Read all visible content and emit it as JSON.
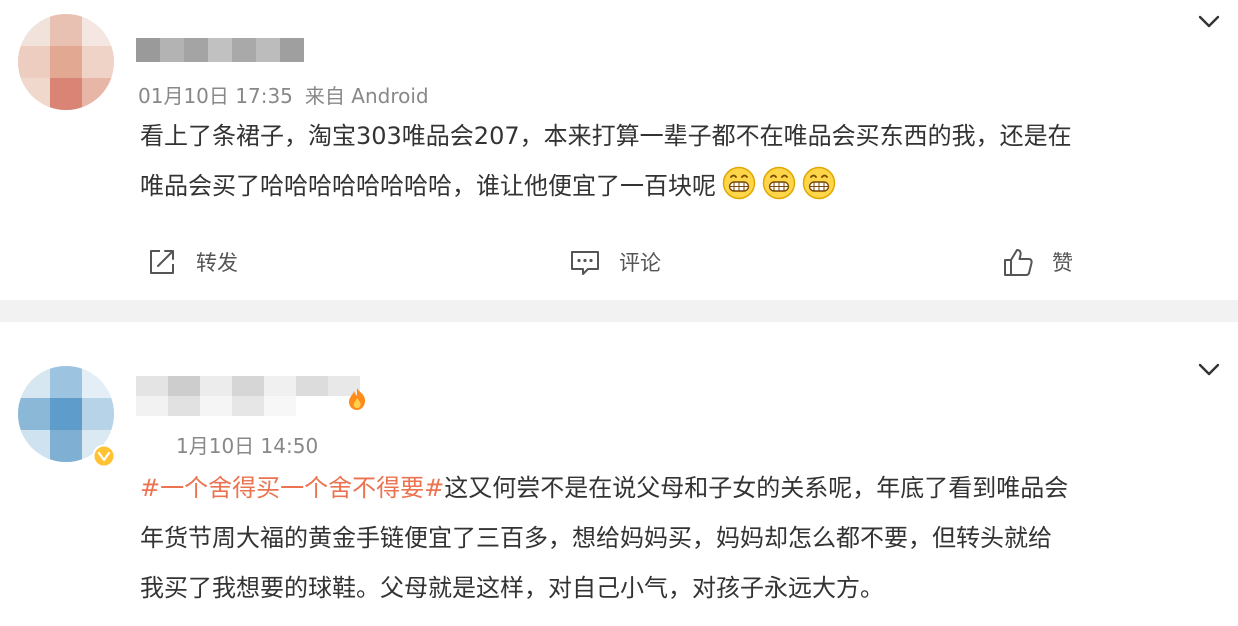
{
  "posts": [
    {
      "time": "01月10日 17:35",
      "source": "来自 Android",
      "content_lines": [
        "看上了条裙子，淘宝303唯品会207，本来打算一辈子都不在唯品会买东西的我，还是在",
        "唯品会买了哈哈哈哈哈哈哈哈，谁让他便宜了一百块呢"
      ],
      "emojis": [
        "grin-emoji",
        "grin-emoji",
        "grin-emoji"
      ],
      "actions": {
        "repost": "转发",
        "comment": "评论",
        "like": "赞"
      }
    },
    {
      "time": "1月10日 14:50",
      "topic": "#一个舍得买一个舍不得要#",
      "content_lines": [
        "这又何尝不是在说父母和子女的关系呢，年底了看到唯品会",
        "年货节周大福的黄金手链便宜了三百多，想给妈妈买，妈妈却怎么都不要，但转头就给",
        "我买了我想要的球鞋。父母就是这样，对自己小气，对孩子永远大方。"
      ]
    }
  ],
  "icons": {
    "expand": "chevron-down-icon",
    "repost": "share-icon",
    "comment": "comment-icon",
    "like": "thumbs-up-icon",
    "emoji": "grin-emoji",
    "badge": "vip-badge-icon"
  },
  "colors": {
    "topic": "#eb7350",
    "meta": "#888888",
    "text": "#333333",
    "divider": "#f2f2f2"
  }
}
